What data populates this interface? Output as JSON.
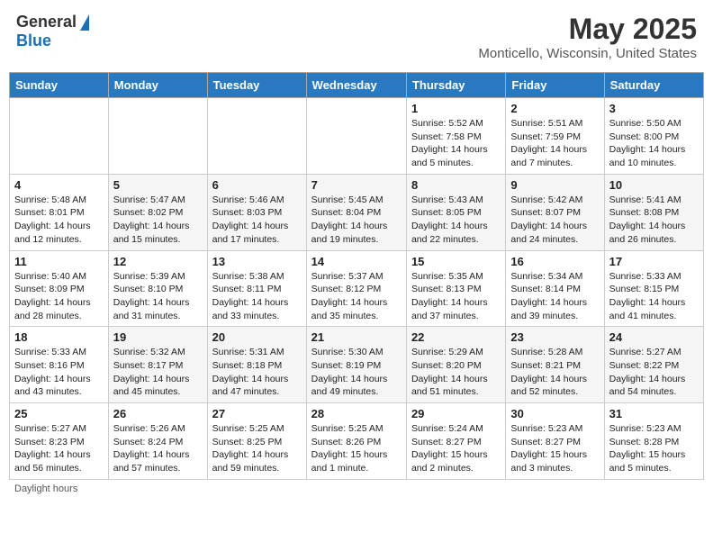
{
  "header": {
    "logo_general": "General",
    "logo_blue": "Blue",
    "title": "May 2025",
    "subtitle": "Monticello, Wisconsin, United States"
  },
  "weekdays": [
    "Sunday",
    "Monday",
    "Tuesday",
    "Wednesday",
    "Thursday",
    "Friday",
    "Saturday"
  ],
  "weeks": [
    [
      {
        "day": "",
        "info": ""
      },
      {
        "day": "",
        "info": ""
      },
      {
        "day": "",
        "info": ""
      },
      {
        "day": "",
        "info": ""
      },
      {
        "day": "1",
        "info": "Sunrise: 5:52 AM\nSunset: 7:58 PM\nDaylight: 14 hours\nand 5 minutes."
      },
      {
        "day": "2",
        "info": "Sunrise: 5:51 AM\nSunset: 7:59 PM\nDaylight: 14 hours\nand 7 minutes."
      },
      {
        "day": "3",
        "info": "Sunrise: 5:50 AM\nSunset: 8:00 PM\nDaylight: 14 hours\nand 10 minutes."
      }
    ],
    [
      {
        "day": "4",
        "info": "Sunrise: 5:48 AM\nSunset: 8:01 PM\nDaylight: 14 hours\nand 12 minutes."
      },
      {
        "day": "5",
        "info": "Sunrise: 5:47 AM\nSunset: 8:02 PM\nDaylight: 14 hours\nand 15 minutes."
      },
      {
        "day": "6",
        "info": "Sunrise: 5:46 AM\nSunset: 8:03 PM\nDaylight: 14 hours\nand 17 minutes."
      },
      {
        "day": "7",
        "info": "Sunrise: 5:45 AM\nSunset: 8:04 PM\nDaylight: 14 hours\nand 19 minutes."
      },
      {
        "day": "8",
        "info": "Sunrise: 5:43 AM\nSunset: 8:05 PM\nDaylight: 14 hours\nand 22 minutes."
      },
      {
        "day": "9",
        "info": "Sunrise: 5:42 AM\nSunset: 8:07 PM\nDaylight: 14 hours\nand 24 minutes."
      },
      {
        "day": "10",
        "info": "Sunrise: 5:41 AM\nSunset: 8:08 PM\nDaylight: 14 hours\nand 26 minutes."
      }
    ],
    [
      {
        "day": "11",
        "info": "Sunrise: 5:40 AM\nSunset: 8:09 PM\nDaylight: 14 hours\nand 28 minutes."
      },
      {
        "day": "12",
        "info": "Sunrise: 5:39 AM\nSunset: 8:10 PM\nDaylight: 14 hours\nand 31 minutes."
      },
      {
        "day": "13",
        "info": "Sunrise: 5:38 AM\nSunset: 8:11 PM\nDaylight: 14 hours\nand 33 minutes."
      },
      {
        "day": "14",
        "info": "Sunrise: 5:37 AM\nSunset: 8:12 PM\nDaylight: 14 hours\nand 35 minutes."
      },
      {
        "day": "15",
        "info": "Sunrise: 5:35 AM\nSunset: 8:13 PM\nDaylight: 14 hours\nand 37 minutes."
      },
      {
        "day": "16",
        "info": "Sunrise: 5:34 AM\nSunset: 8:14 PM\nDaylight: 14 hours\nand 39 minutes."
      },
      {
        "day": "17",
        "info": "Sunrise: 5:33 AM\nSunset: 8:15 PM\nDaylight: 14 hours\nand 41 minutes."
      }
    ],
    [
      {
        "day": "18",
        "info": "Sunrise: 5:33 AM\nSunset: 8:16 PM\nDaylight: 14 hours\nand 43 minutes."
      },
      {
        "day": "19",
        "info": "Sunrise: 5:32 AM\nSunset: 8:17 PM\nDaylight: 14 hours\nand 45 minutes."
      },
      {
        "day": "20",
        "info": "Sunrise: 5:31 AM\nSunset: 8:18 PM\nDaylight: 14 hours\nand 47 minutes."
      },
      {
        "day": "21",
        "info": "Sunrise: 5:30 AM\nSunset: 8:19 PM\nDaylight: 14 hours\nand 49 minutes."
      },
      {
        "day": "22",
        "info": "Sunrise: 5:29 AM\nSunset: 8:20 PM\nDaylight: 14 hours\nand 51 minutes."
      },
      {
        "day": "23",
        "info": "Sunrise: 5:28 AM\nSunset: 8:21 PM\nDaylight: 14 hours\nand 52 minutes."
      },
      {
        "day": "24",
        "info": "Sunrise: 5:27 AM\nSunset: 8:22 PM\nDaylight: 14 hours\nand 54 minutes."
      }
    ],
    [
      {
        "day": "25",
        "info": "Sunrise: 5:27 AM\nSunset: 8:23 PM\nDaylight: 14 hours\nand 56 minutes."
      },
      {
        "day": "26",
        "info": "Sunrise: 5:26 AM\nSunset: 8:24 PM\nDaylight: 14 hours\nand 57 minutes."
      },
      {
        "day": "27",
        "info": "Sunrise: 5:25 AM\nSunset: 8:25 PM\nDaylight: 14 hours\nand 59 minutes."
      },
      {
        "day": "28",
        "info": "Sunrise: 5:25 AM\nSunset: 8:26 PM\nDaylight: 15 hours\nand 1 minute."
      },
      {
        "day": "29",
        "info": "Sunrise: 5:24 AM\nSunset: 8:27 PM\nDaylight: 15 hours\nand 2 minutes."
      },
      {
        "day": "30",
        "info": "Sunrise: 5:23 AM\nSunset: 8:27 PM\nDaylight: 15 hours\nand 3 minutes."
      },
      {
        "day": "31",
        "info": "Sunrise: 5:23 AM\nSunset: 8:28 PM\nDaylight: 15 hours\nand 5 minutes."
      }
    ]
  ],
  "footer": "Daylight hours"
}
